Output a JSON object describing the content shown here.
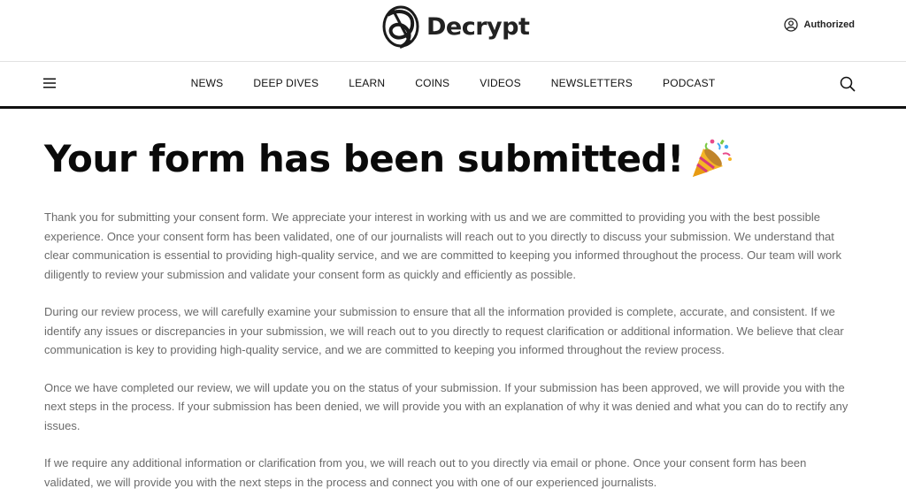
{
  "header": {
    "logo_text": "Decrypt",
    "account_label": "Authorized"
  },
  "nav": {
    "items": [
      {
        "label": "NEWS"
      },
      {
        "label": "DEEP DIVES"
      },
      {
        "label": "LEARN"
      },
      {
        "label": "COINS"
      },
      {
        "label": "VIDEOS"
      },
      {
        "label": "NEWSLETTERS"
      },
      {
        "label": "PODCAST"
      }
    ],
    "menu_icon": "hamburger-menu-icon",
    "search_icon": "search-icon"
  },
  "main": {
    "title": "Your form has been submitted!",
    "title_emoji": "party-popper-icon",
    "paragraphs": [
      "Thank you for submitting your consent form. We appreciate your interest in working with us and we are committed to providing you with the best possible experience. Once your consent form has been validated, one of our journalists will reach out to you directly to discuss your submission. We understand that clear communication is essential to providing high-quality service, and we are committed to keeping you informed throughout the process. Our team will work diligently to review your submission and validate your consent form as quickly and efficiently as possible.",
      "During our review process, we will carefully examine your submission to ensure that all the information provided is complete, accurate, and consistent. If we identify any issues or discrepancies in your submission, we will reach out to you directly to request clarification or additional information. We believe that clear communication is key to providing high-quality service, and we are committed to keeping you informed throughout the review process.",
      "Once we have completed our review, we will update you on the status of your submission. If your submission has been approved, we will provide you with the next steps in the process. If your submission has been denied, we will provide you with an explanation of why it was denied and what you can do to rectify any issues.",
      "If we require any additional information or clarification from you, we will reach out to you directly via email or phone. Once your consent form has been validated, we will provide you with the next steps in the process and connect you with one of our experienced journalists."
    ]
  },
  "colors": {
    "text_dark": "#111111",
    "body_text": "#6b6b6b",
    "divider": "#e2e2e2"
  }
}
